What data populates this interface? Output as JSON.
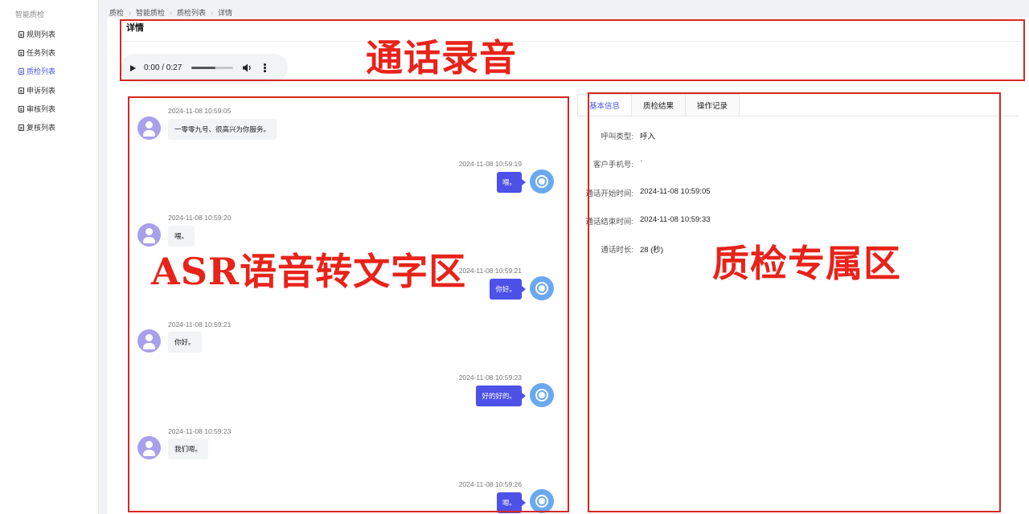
{
  "sidebar": {
    "group": "智能质检",
    "items": [
      {
        "label": "规则列表"
      },
      {
        "label": "任务列表"
      },
      {
        "label": "质检列表"
      },
      {
        "label": "申诉列表"
      },
      {
        "label": "审核列表"
      },
      {
        "label": "复核列表"
      }
    ],
    "active_index": 2
  },
  "breadcrumb": [
    "质检",
    "智能质检",
    "质检列表",
    "详情"
  ],
  "page": {
    "title": "详情"
  },
  "audio": {
    "current": "0:00",
    "duration": "0:27",
    "time_display": "0:00 / 0:27",
    "progress": 0.0
  },
  "annotations": {
    "recording": "通话录音",
    "asr": "ASR语音转文字区",
    "qc": "质检专属区"
  },
  "chat": [
    {
      "side": "user",
      "time": "2024-11-08 10:59:05",
      "text": "一零零九号、很高兴为你服务。"
    },
    {
      "side": "agent",
      "time": "2024-11-08 10:59:19",
      "text": "喂。"
    },
    {
      "side": "user",
      "time": "2024-11-08 10:59:20",
      "text": "喂。"
    },
    {
      "side": "agent",
      "time": "2024-11-08 10:59:21",
      "text": "你好。"
    },
    {
      "side": "user",
      "time": "2024-11-08 10:59:21",
      "text": "你好。"
    },
    {
      "side": "agent",
      "time": "2024-11-08 10:59:23",
      "text": "好的好的。"
    },
    {
      "side": "user",
      "time": "2024-11-08 10:59:23",
      "text": "我们嗯。"
    },
    {
      "side": "agent",
      "time": "2024-11-08 10:59:26",
      "text": "嗯。"
    }
  ],
  "tabs": [
    {
      "label": "基本信息"
    },
    {
      "label": "质检结果"
    },
    {
      "label": "操作记录"
    }
  ],
  "active_tab": 0,
  "info": [
    {
      "label": "呼叫类型:",
      "value": "呼入"
    },
    {
      "label": "客户手机号:",
      "value": "·"
    },
    {
      "label": "通话开始时间:",
      "value": "2024-11-08 10:59:05"
    },
    {
      "label": "通话结束时间:",
      "value": "2024-11-08 10:59:33"
    },
    {
      "label": "通话时长:",
      "value": "28 (秒)"
    }
  ]
}
